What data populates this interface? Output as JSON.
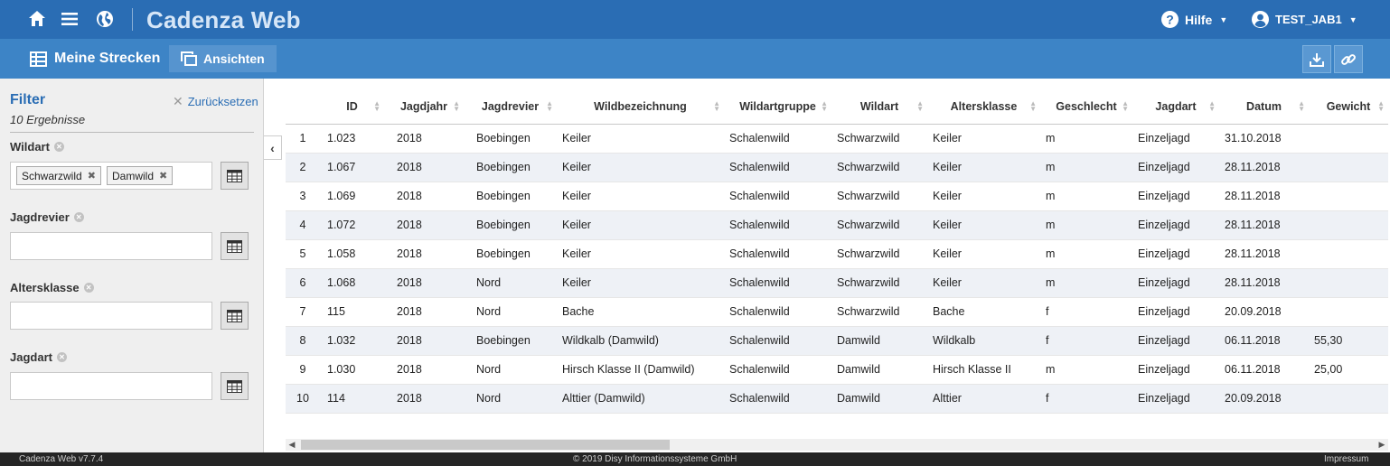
{
  "app": {
    "brand": "Cadenza Web",
    "help_label": "Hilfe",
    "user_label": "TEST_JAB1",
    "colors": {
      "primary": "#2a6db4",
      "secondary": "#3d84c6",
      "footer": "#252525"
    }
  },
  "subbar": {
    "title": "Meine Strecken",
    "views_label": "Ansichten"
  },
  "filter": {
    "title": "Filter",
    "reset_label": "Zurücksetzen",
    "result_count": "10 Ergebnisse",
    "fields": [
      {
        "label": "Wildart",
        "tags": [
          "Schwarzwild",
          "Damwild"
        ],
        "value": ""
      },
      {
        "label": "Jagdrevier",
        "tags": [],
        "value": ""
      },
      {
        "label": "Altersklasse",
        "tags": [],
        "value": ""
      },
      {
        "label": "Jagdart",
        "tags": [],
        "value": ""
      }
    ]
  },
  "table": {
    "columns": [
      "",
      "ID",
      "Jagdjahr",
      "Jagdrevier",
      "Wildbezeichnung",
      "Wildartgruppe",
      "Wildart",
      "Altersklasse",
      "Geschlecht",
      "Jagdart",
      "Datum",
      "Gewicht"
    ],
    "rows": [
      [
        "1",
        "1.023",
        "2018",
        "Boebingen",
        "Keiler",
        "Schalenwild",
        "Schwarzwild",
        "Keiler",
        "m",
        "Einzeljagd",
        "31.10.2018",
        ""
      ],
      [
        "2",
        "1.067",
        "2018",
        "Boebingen",
        "Keiler",
        "Schalenwild",
        "Schwarzwild",
        "Keiler",
        "m",
        "Einzeljagd",
        "28.11.2018",
        ""
      ],
      [
        "3",
        "1.069",
        "2018",
        "Boebingen",
        "Keiler",
        "Schalenwild",
        "Schwarzwild",
        "Keiler",
        "m",
        "Einzeljagd",
        "28.11.2018",
        ""
      ],
      [
        "4",
        "1.072",
        "2018",
        "Boebingen",
        "Keiler",
        "Schalenwild",
        "Schwarzwild",
        "Keiler",
        "m",
        "Einzeljagd",
        "28.11.2018",
        ""
      ],
      [
        "5",
        "1.058",
        "2018",
        "Boebingen",
        "Keiler",
        "Schalenwild",
        "Schwarzwild",
        "Keiler",
        "m",
        "Einzeljagd",
        "28.11.2018",
        ""
      ],
      [
        "6",
        "1.068",
        "2018",
        "Nord",
        "Keiler",
        "Schalenwild",
        "Schwarzwild",
        "Keiler",
        "m",
        "Einzeljagd",
        "28.11.2018",
        ""
      ],
      [
        "7",
        "115",
        "2018",
        "Nord",
        "Bache",
        "Schalenwild",
        "Schwarzwild",
        "Bache",
        "f",
        "Einzeljagd",
        "20.09.2018",
        ""
      ],
      [
        "8",
        "1.032",
        "2018",
        "Boebingen",
        "Wildkalb (Damwild)",
        "Schalenwild",
        "Damwild",
        "Wildkalb",
        "f",
        "Einzeljagd",
        "06.11.2018",
        "55,30"
      ],
      [
        "9",
        "1.030",
        "2018",
        "Nord",
        "Hirsch Klasse II (Damwild)",
        "Schalenwild",
        "Damwild",
        "Hirsch Klasse II",
        "m",
        "Einzeljagd",
        "06.11.2018",
        "25,00"
      ],
      [
        "10",
        "114",
        "2018",
        "Nord",
        "Alttier (Damwild)",
        "Schalenwild",
        "Damwild",
        "Alttier",
        "f",
        "Einzeljagd",
        "20.09.2018",
        ""
      ]
    ]
  },
  "footer": {
    "version": "Cadenza Web v7.7.4",
    "copyright": "© 2019 Disy Informationssysteme GmbH",
    "impressum": "Impressum"
  }
}
